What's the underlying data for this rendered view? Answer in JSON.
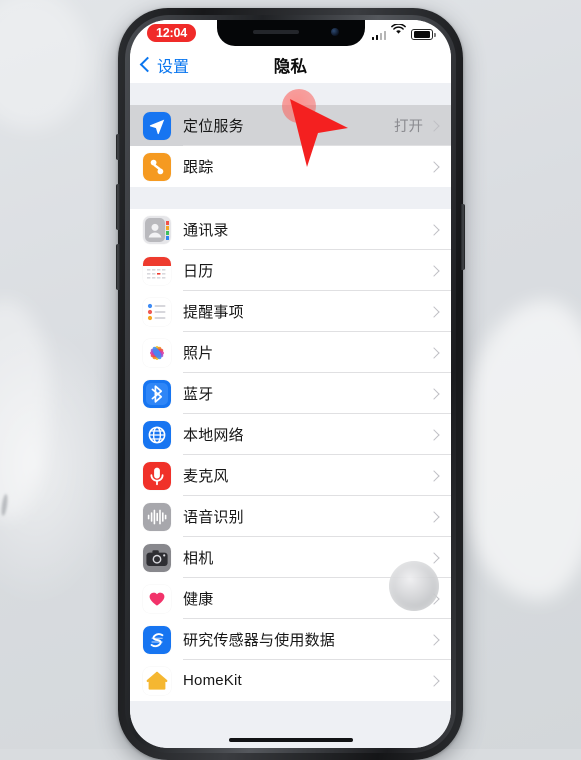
{
  "device": {
    "name": "iphone-x",
    "frame_color": "#232528"
  },
  "status_bar": {
    "time": "12:04",
    "time_badge_color": "#f02b29",
    "signal_icon": "cellular-signal-icon",
    "wifi_icon": "wifi-icon",
    "battery_icon": "battery-icon"
  },
  "nav": {
    "back_label": "设置",
    "back_icon": "chevron-left-icon",
    "title": "隐私",
    "accent_color": "#0a76ef"
  },
  "overlays": {
    "pointer_icon": "red-pointer-cursor",
    "pointer_color": "#f42020",
    "tap_ripple_icon": "tap-ripple-indicator",
    "assistive_touch_icon": "assistive-touch-button",
    "home_indicator_icon": "home-indicator-bar"
  },
  "list": {
    "groups": [
      {
        "rows": [
          {
            "label": "定位服务",
            "value": "打开",
            "icon": "location-services-icon",
            "icon_color": "#1775f1",
            "pressed": true,
            "chevron": "chevron-right-icon"
          },
          {
            "label": "跟踪",
            "value": "",
            "icon": "tracking-icon",
            "icon_color": "#f59a21",
            "pressed": false,
            "chevron": "chevron-right-icon"
          }
        ]
      },
      {
        "rows": [
          {
            "label": "通讯录",
            "value": "",
            "icon": "contacts-icon",
            "icon_color": "#b9b9bd",
            "pressed": false,
            "chevron": "chevron-right-icon"
          },
          {
            "label": "日历",
            "value": "",
            "icon": "calendar-icon",
            "icon_color": "#ffffff",
            "pressed": false,
            "chevron": "chevron-right-icon"
          },
          {
            "label": "提醒事项",
            "value": "",
            "icon": "reminders-icon",
            "icon_color": "#ffffff",
            "pressed": false,
            "chevron": "chevron-right-icon"
          },
          {
            "label": "照片",
            "value": "",
            "icon": "photos-icon",
            "icon_color": "#ffffff",
            "pressed": false,
            "chevron": "chevron-right-icon"
          },
          {
            "label": "蓝牙",
            "value": "",
            "icon": "bluetooth-icon",
            "icon_color": "#1775f1",
            "pressed": false,
            "chevron": "chevron-right-icon"
          },
          {
            "label": "本地网络",
            "value": "",
            "icon": "local-network-icon",
            "icon_color": "#1775f1",
            "pressed": false,
            "chevron": "chevron-right-icon"
          },
          {
            "label": "麦克风",
            "value": "",
            "icon": "microphone-icon",
            "icon_color": "#f03129",
            "pressed": false,
            "chevron": "chevron-right-icon"
          },
          {
            "label": "语音识别",
            "value": "",
            "icon": "speech-recognition-icon",
            "icon_color": "#a7a7ac",
            "pressed": false,
            "chevron": "chevron-right-icon"
          },
          {
            "label": "相机",
            "value": "",
            "icon": "camera-icon",
            "icon_color": "#6e6e73",
            "pressed": false,
            "chevron": "chevron-right-icon"
          },
          {
            "label": "健康",
            "value": "",
            "icon": "health-icon",
            "icon_color": "#ffffff",
            "pressed": false,
            "chevron": "chevron-right-icon"
          },
          {
            "label": "研究传感器与使用数据",
            "value": "",
            "icon": "research-sensor-icon",
            "icon_color": "#1775f1",
            "pressed": false,
            "chevron": "chevron-right-icon"
          },
          {
            "label": "HomeKit",
            "value": "",
            "icon": "homekit-icon",
            "icon_color": "#ffffff",
            "pressed": false,
            "chevron": "chevron-right-icon"
          }
        ]
      }
    ]
  }
}
